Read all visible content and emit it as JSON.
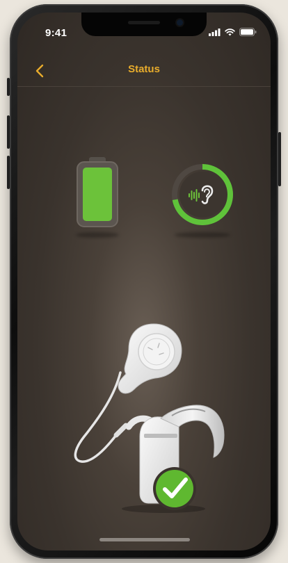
{
  "status_bar": {
    "time": "9:41"
  },
  "nav": {
    "title": "Status"
  },
  "battery": {
    "level": 1.0,
    "fill_color": "#6cc23a"
  },
  "sound_processor_signal": {
    "level": 0.72,
    "ring_color": "#5fc23a"
  },
  "device_status": {
    "state": "connected",
    "check_color": "#5fb830"
  },
  "colors": {
    "accent": "#e8ac2c",
    "background": "#3a332d"
  }
}
